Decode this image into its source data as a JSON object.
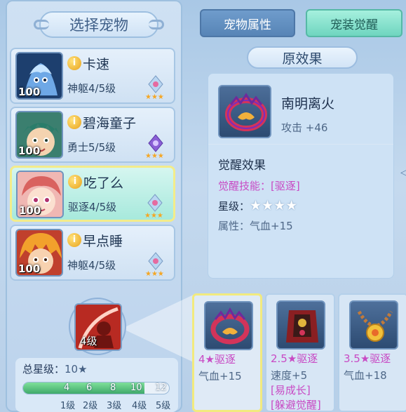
{
  "left_panel": {
    "title": "选择宠物",
    "pets": [
      {
        "name": "卡速",
        "rank": "神躯4/5级",
        "level": "100",
        "selected": false
      },
      {
        "name": "碧海童子",
        "rank": "勇士5/5级",
        "level": "100",
        "selected": false
      },
      {
        "name": "吃了么",
        "rank": "驱逐4/5级",
        "level": "100",
        "selected": true
      },
      {
        "name": "早点睡",
        "rank": "神躯4/5级",
        "level": "100",
        "selected": false
      }
    ],
    "info_icon": "i",
    "skill_level": "4级",
    "total_stars_label": "总星级：",
    "total_stars_value": "10★",
    "progress": {
      "fraction": 0.83,
      "ticks": [
        "4",
        "6",
        "8",
        "10",
        "12"
      ],
      "levels": [
        "1级",
        "2级",
        "3级",
        "4级",
        "5级"
      ]
    }
  },
  "tabs": [
    {
      "label": "宠物属性",
      "active": false
    },
    {
      "label": "宠装觉醒",
      "active": true
    }
  ],
  "original_effect": {
    "title": "原效果",
    "item_name": "南明离火",
    "item_stat": "攻击 +46",
    "awaken_header": "觉醒效果",
    "awaken_skill": "觉醒技能：[驱逐]",
    "star_label": "星级：",
    "star_count": 4,
    "stars": "★★★★",
    "attr": "属性：气血+15"
  },
  "cards": [
    {
      "title": "4★驱逐",
      "attr": "气血+15",
      "extra": [],
      "selected": true
    },
    {
      "title": "2.5★驱逐",
      "attr": "速度+5",
      "extra": [
        "[易成长]",
        "[躲避觉醒]"
      ],
      "selected": false
    },
    {
      "title": "3.5★驱逐",
      "attr": "气血+18",
      "extra": [],
      "selected": false
    }
  ],
  "colors": {
    "accent_pink": "#c84ac4",
    "tab_active": "#6fd5bf",
    "tab_inactive": "#5784b6",
    "progress": "#3fa96a"
  },
  "icons": [
    "info-icon",
    "quality-badge-icon",
    "skill-icon",
    "equipment-ring-icon",
    "equipment-armor-icon",
    "equipment-necklace-icon",
    "star-icon"
  ]
}
